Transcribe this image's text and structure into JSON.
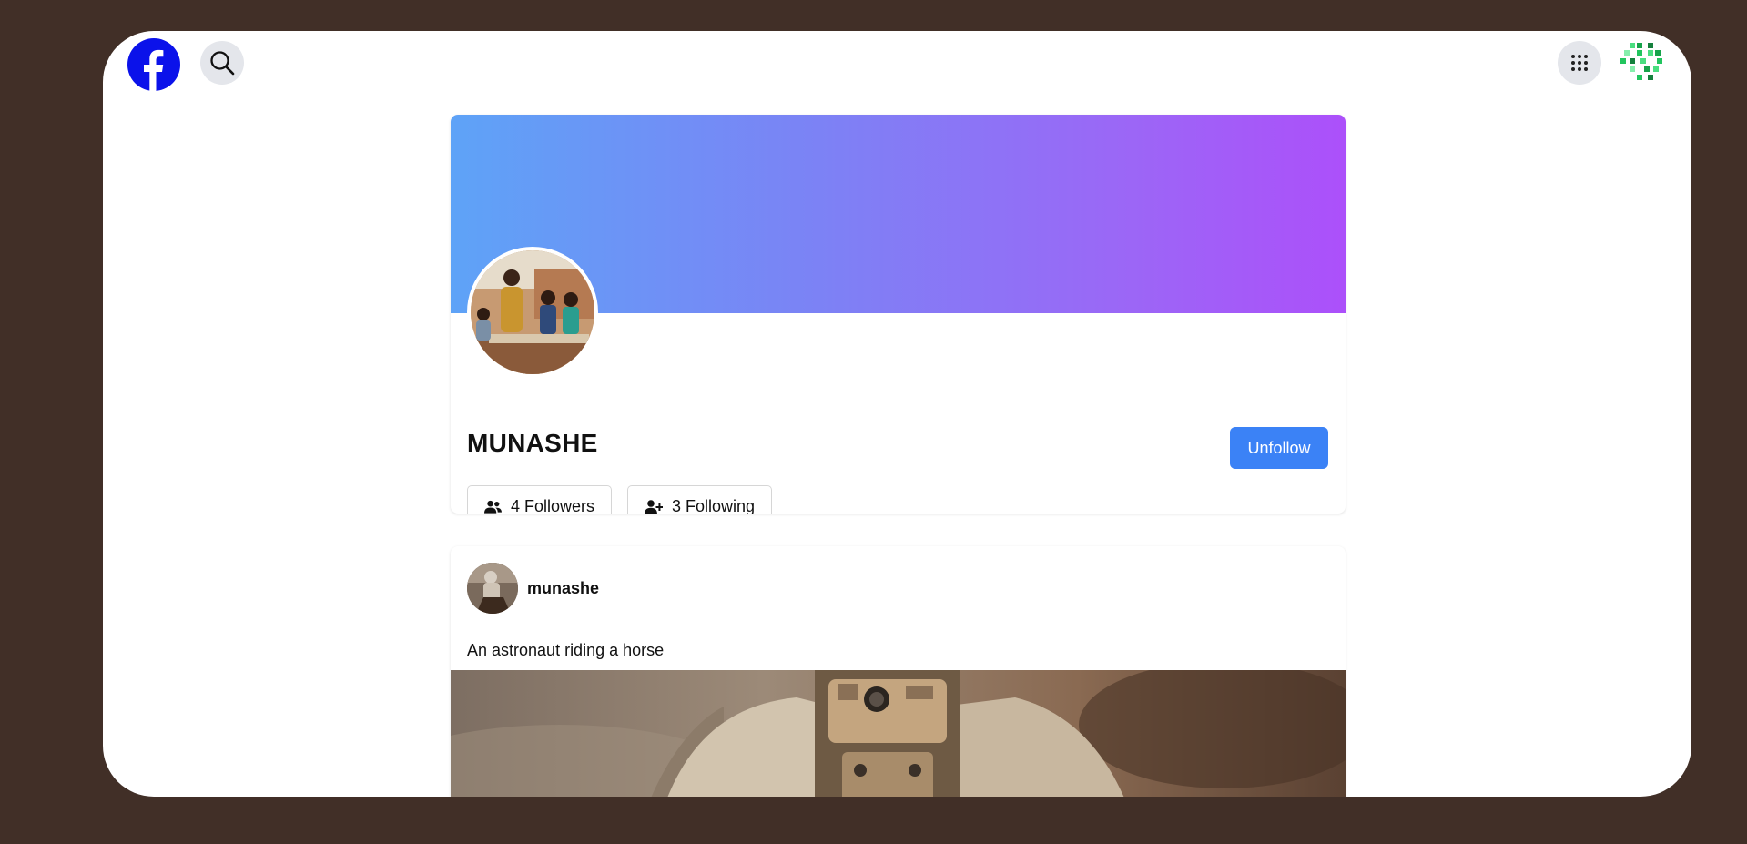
{
  "nav": {
    "logo_icon": "facebook-logo-icon",
    "search_icon": "search-icon",
    "apps_icon": "grid-menu-icon",
    "account_icon": "user-identicon"
  },
  "profile": {
    "name": "MUNASHE",
    "action_button": "Unfollow",
    "followers": {
      "count": "4",
      "label": "Followers",
      "icon": "users-icon"
    },
    "following": {
      "count": "3",
      "label": "Following",
      "icon": "user-plus-icon"
    },
    "colors": {
      "cover_start": "#5ea3f7",
      "cover_end": "#ac50fa",
      "accent": "#3b82f6"
    }
  },
  "post": {
    "author": "munashe",
    "text": "An astronaut riding a horse"
  }
}
